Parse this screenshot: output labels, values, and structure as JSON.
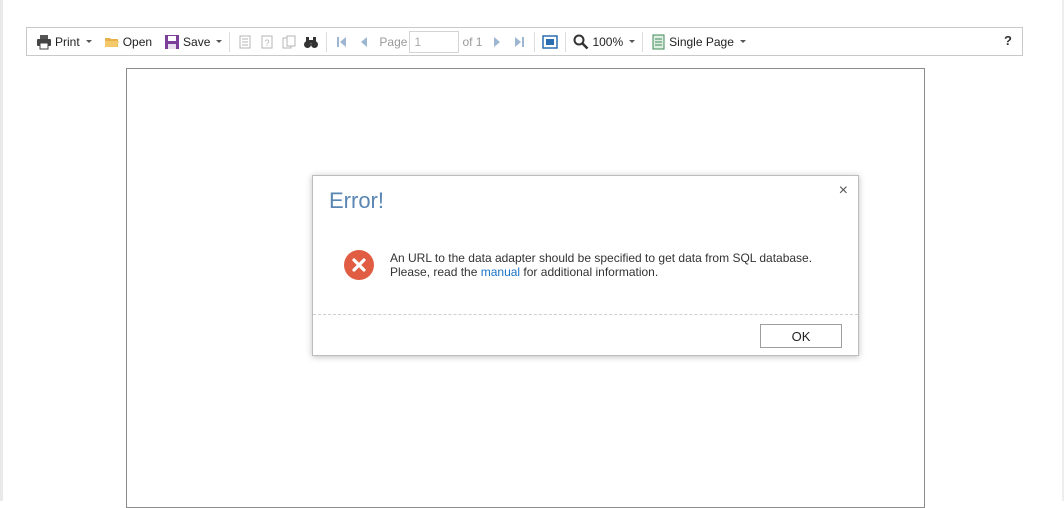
{
  "toolbar": {
    "print_label": "Print",
    "open_label": "Open",
    "save_label": "Save",
    "page_label": "Page",
    "page_value": "1",
    "of_label": "of 1",
    "zoom_label": "100%",
    "view_mode_label": "Single Page",
    "help_label": "?"
  },
  "dialog": {
    "title": "Error!",
    "close_label": "×",
    "message_line1": "An URL to the data adapter should be specified to get data from SQL database.",
    "message_line2_pre": "Please, read the ",
    "message_link": "manual",
    "message_line2_post": " for additional information.",
    "ok_label": "OK"
  },
  "colors": {
    "title_color": "#5a86b3",
    "link_color": "#1a73c7",
    "error_icon_color": "#e05d44",
    "save_icon_color": "#7b3f9a"
  }
}
